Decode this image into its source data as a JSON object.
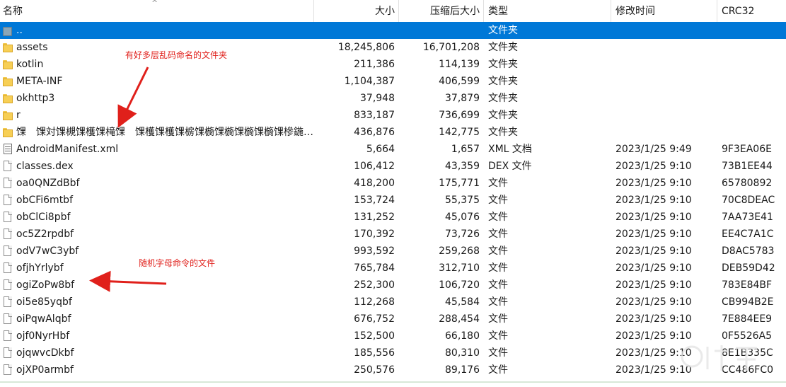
{
  "columns": {
    "name": "名称",
    "size": "大小",
    "packed": "压缩后大小",
    "type": "类型",
    "mtime": "修改时间",
    "crc": "CRC32"
  },
  "rows": [
    {
      "icon": "up-folder-icon",
      "name": "..",
      "size": "",
      "packed": "",
      "type": "文件夹",
      "mtime": "",
      "crc": "",
      "selected": true
    },
    {
      "icon": "folder-icon",
      "name": "assets",
      "size": "18,245,806",
      "packed": "16,701,208",
      "type": "文件夹",
      "mtime": "",
      "crc": ""
    },
    {
      "icon": "folder-icon",
      "name": "kotlin",
      "size": "211,386",
      "packed": "114,139",
      "type": "文件夹",
      "mtime": "",
      "crc": ""
    },
    {
      "icon": "folder-icon",
      "name": "META-INF",
      "size": "1,104,387",
      "packed": "406,599",
      "type": "文件夹",
      "mtime": "",
      "crc": ""
    },
    {
      "icon": "folder-icon",
      "name": "okhttp3",
      "size": "37,948",
      "packed": "37,879",
      "type": "文件夹",
      "mtime": "",
      "crc": ""
    },
    {
      "icon": "folder-icon",
      "name": "r",
      "size": "833,187",
      "packed": "736,699",
      "type": "文件夹",
      "mtime": "",
      "crc": ""
    },
    {
      "icon": "folder-icon",
      "name": "馃　馃対馃槻馃檴馃槞馃　馃檴馃檴馃椖馃檹馃檹馃檹馃檹馃槮鍦…",
      "size": "436,876",
      "packed": "142,775",
      "type": "文件夹",
      "mtime": "",
      "crc": ""
    },
    {
      "icon": "xml-file-icon",
      "name": "AndroidManifest.xml",
      "size": "5,664",
      "packed": "1,657",
      "type": "XML 文档",
      "mtime": "2023/1/25 9:49",
      "crc": "9F3EA06E"
    },
    {
      "icon": "file-icon",
      "name": "classes.dex",
      "size": "106,412",
      "packed": "43,359",
      "type": "DEX 文件",
      "mtime": "2023/1/25 9:10",
      "crc": "73B1EE44"
    },
    {
      "icon": "file-icon",
      "name": "oa0QNZdBbf",
      "size": "418,200",
      "packed": "175,771",
      "type": "文件",
      "mtime": "2023/1/25 9:10",
      "crc": "65780892"
    },
    {
      "icon": "file-icon",
      "name": "obCFi6mtbf",
      "size": "153,724",
      "packed": "55,375",
      "type": "文件",
      "mtime": "2023/1/25 9:10",
      "crc": "70C8DEAC"
    },
    {
      "icon": "file-icon",
      "name": "obClCi8pbf",
      "size": "131,252",
      "packed": "45,076",
      "type": "文件",
      "mtime": "2023/1/25 9:10",
      "crc": "7AA73E41"
    },
    {
      "icon": "file-icon",
      "name": "oc5Z2rpdbf",
      "size": "170,392",
      "packed": "73,726",
      "type": "文件",
      "mtime": "2023/1/25 9:10",
      "crc": "EE4C7A1C"
    },
    {
      "icon": "file-icon",
      "name": "odV7wC3ybf",
      "size": "993,592",
      "packed": "259,268",
      "type": "文件",
      "mtime": "2023/1/25 9:10",
      "crc": "D8AC5783"
    },
    {
      "icon": "file-icon",
      "name": "ofjhYrlybf",
      "size": "765,784",
      "packed": "312,710",
      "type": "文件",
      "mtime": "2023/1/25 9:10",
      "crc": "DEB59D42"
    },
    {
      "icon": "file-icon",
      "name": "ogiZoPw8bf",
      "size": "252,300",
      "packed": "106,720",
      "type": "文件",
      "mtime": "2023/1/25 9:10",
      "crc": "783E84BF"
    },
    {
      "icon": "file-icon",
      "name": "oi5e85yqbf",
      "size": "112,268",
      "packed": "45,584",
      "type": "文件",
      "mtime": "2023/1/25 9:10",
      "crc": "CB994B2E"
    },
    {
      "icon": "file-icon",
      "name": "oiPqwAlqbf",
      "size": "676,752",
      "packed": "288,454",
      "type": "文件",
      "mtime": "2023/1/25 9:10",
      "crc": "7E884EE9"
    },
    {
      "icon": "file-icon",
      "name": "ojf0NyrHbf",
      "size": "152,500",
      "packed": "66,180",
      "type": "文件",
      "mtime": "2023/1/25 9:10",
      "crc": "0F5526A5"
    },
    {
      "icon": "file-icon",
      "name": "ojqwvcDkbf",
      "size": "185,556",
      "packed": "80,310",
      "type": "文件",
      "mtime": "2023/1/25 9:10",
      "crc": "8E1B335C"
    },
    {
      "icon": "file-icon",
      "name": "ojXP0armbf",
      "size": "250,576",
      "packed": "89,176",
      "type": "文件",
      "mtime": "2023/1/25 9:10",
      "crc": "CC486FC0"
    }
  ],
  "annotations": {
    "folders_note": "有好多层乱码命名的文件夹",
    "files_note": "随机字母命令的文件"
  },
  "colors": {
    "selection": "#0078d7",
    "annotation": "#e0201b",
    "folder": "#f7cf55"
  }
}
